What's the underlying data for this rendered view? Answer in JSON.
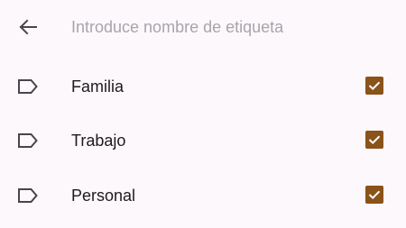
{
  "header": {
    "back_icon": "arrow-left-icon",
    "search_placeholder": "Introduce nombre de etiqueta",
    "search_value": ""
  },
  "labels": [
    {
      "name": "Familia",
      "checked": true,
      "icon": "label-outline-icon"
    },
    {
      "name": "Trabajo",
      "checked": true,
      "icon": "label-outline-icon"
    },
    {
      "name": "Personal",
      "checked": true,
      "icon": "label-outline-icon"
    }
  ],
  "colors": {
    "background": "#fdf8fc",
    "checkbox_fill": "#8a5319",
    "text": "#1d1b1e",
    "placeholder": "#a9a4ab"
  }
}
